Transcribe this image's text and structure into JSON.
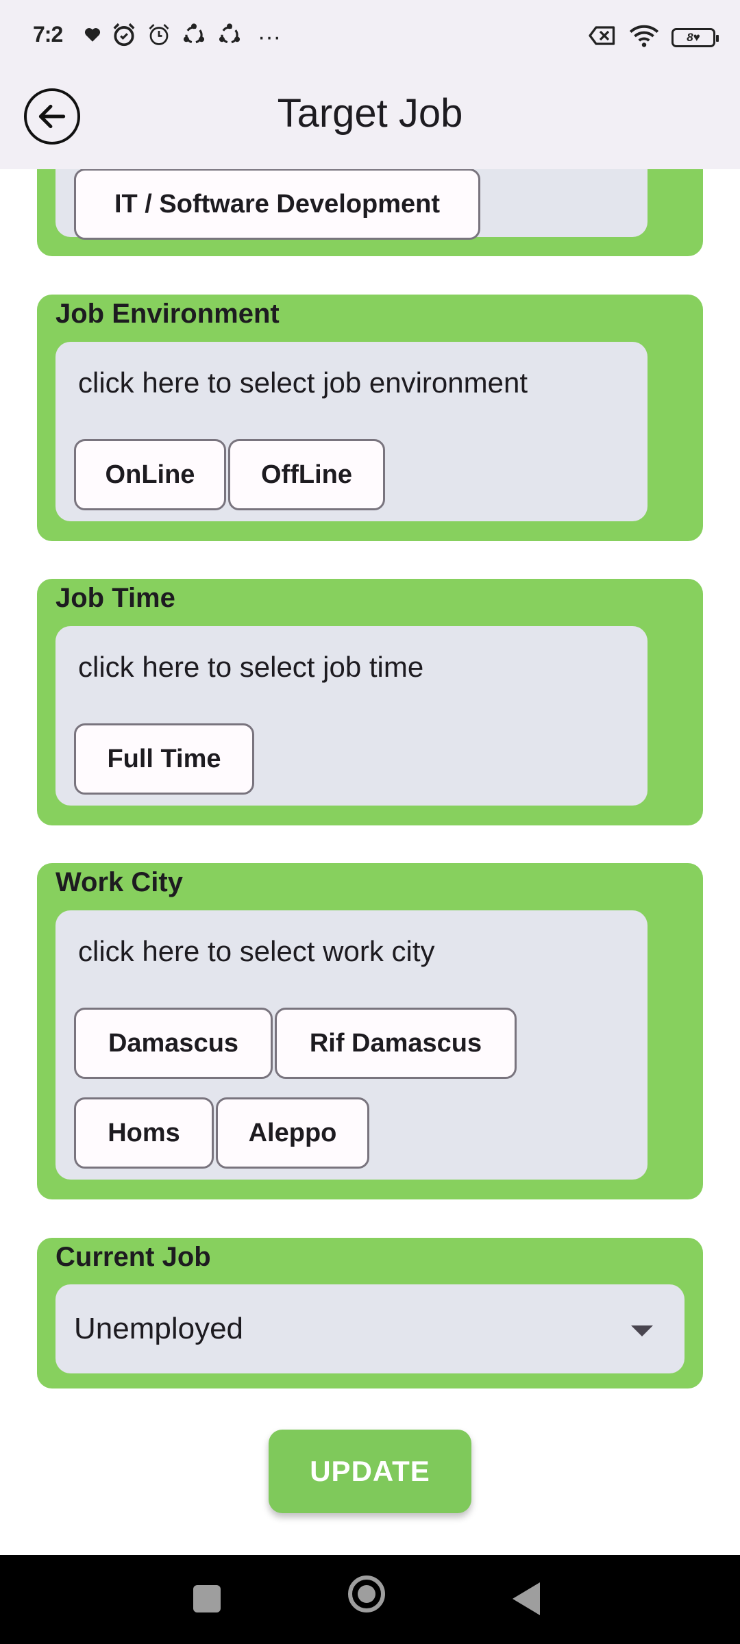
{
  "status_bar": {
    "time": "7:2",
    "battery": "8",
    "left_icons": [
      "heart-icon",
      "alarm-icon",
      "alarm-outline-icon",
      "sync-icon",
      "sync-icon"
    ],
    "more": "···",
    "right_icons": [
      "sim-off-icon",
      "wifi-icon",
      "battery-icon"
    ]
  },
  "app_bar": {
    "title": "Target Job",
    "back_icon": "arrow-back-icon"
  },
  "job_field": {
    "chips": [
      "IT / Software Development"
    ]
  },
  "job_environment": {
    "title": "Job Environment",
    "hint": "click here to select job environment",
    "chips": [
      "OnLine",
      "OffLine"
    ]
  },
  "job_time": {
    "title": "Job Time",
    "hint": "click here to select job time",
    "chips": [
      "Full Time"
    ]
  },
  "work_city": {
    "title": "Work City",
    "hint": "click here to select work city",
    "chips": [
      "Damascus",
      "Rif Damascus",
      "Homs",
      "Aleppo"
    ]
  },
  "current_job": {
    "title": "Current Job",
    "selected": "Unemployed"
  },
  "update_button": "UPDATE",
  "colors": {
    "card_green": "#87d05e",
    "button_green": "#7fc95b",
    "inner_gray": "#e3e5ed",
    "appbar_bg": "#f2eff5"
  }
}
